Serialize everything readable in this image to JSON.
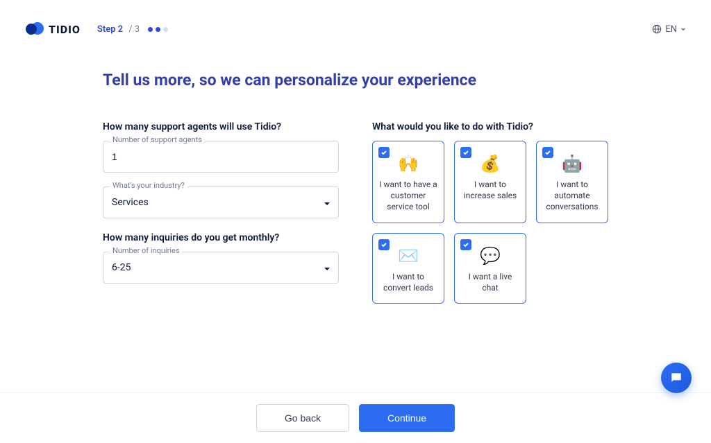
{
  "brand": "TIDIO",
  "step": {
    "label": "Step 2",
    "total": "/ 3"
  },
  "lang": "EN",
  "title": "Tell us more, so we can personalize your experience",
  "agents": {
    "label": "How many support agents will use Tidio?",
    "fieldLabel": "Number of support agents",
    "value": "1"
  },
  "industry": {
    "fieldLabel": "What's your industry?",
    "value": "Services"
  },
  "inquiries": {
    "label": "How many inquiries do you get monthly?",
    "fieldLabel": "Number of inquiries",
    "value": "6-25"
  },
  "goals": {
    "label": "What would you like to do with Tidio?",
    "cards": [
      {
        "icon": "🙌",
        "label": "I want to have a customer service tool"
      },
      {
        "icon": "💰",
        "label": "I want to increase sales"
      },
      {
        "icon": "🤖",
        "label": "I want to automate conversations"
      },
      {
        "icon": "✉️",
        "label": "I want to convert leads"
      },
      {
        "icon": "💬",
        "label": "I want a live chat"
      }
    ]
  },
  "footer": {
    "back": "Go back",
    "continue": "Continue"
  }
}
